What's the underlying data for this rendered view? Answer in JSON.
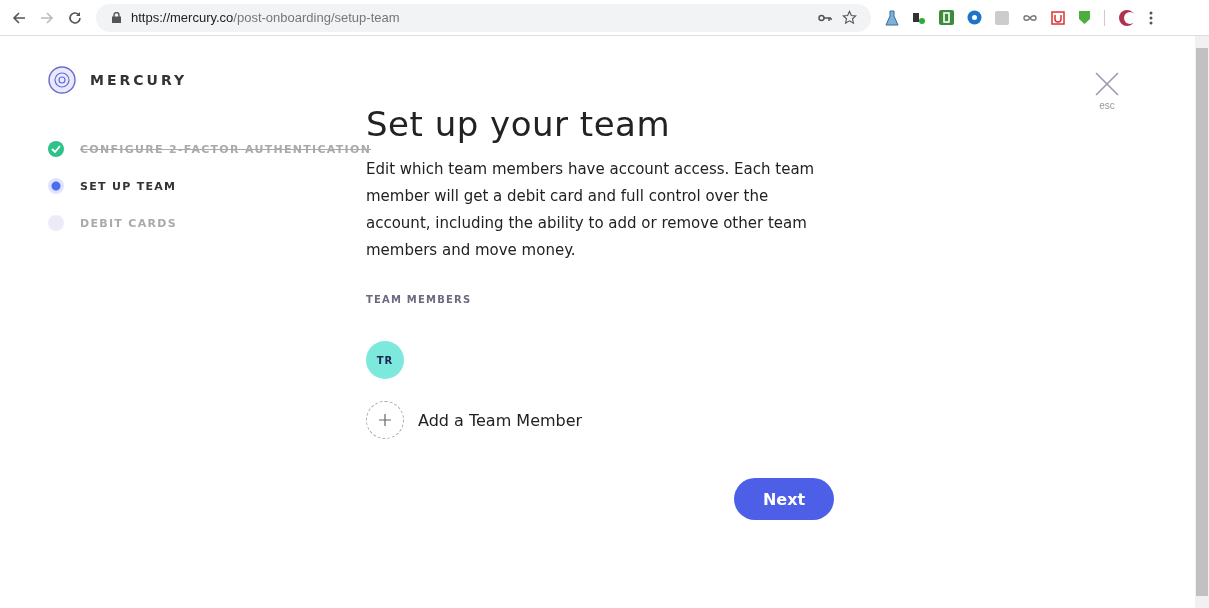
{
  "browser": {
    "url_host": "https://mercury.co",
    "url_path": "/post-onboarding/setup-team"
  },
  "brand": {
    "name": "MERCURY"
  },
  "steps": [
    {
      "label": "CONFIGURE 2-FACTOR AUTHENTICATION",
      "completed": true,
      "selected": false
    },
    {
      "label": "SET UP TEAM",
      "completed": false,
      "selected": true
    },
    {
      "label": "DEBIT CARDS",
      "completed": false,
      "selected": false
    }
  ],
  "close": {
    "hint": "esc"
  },
  "title": "Set up your team",
  "description": "Edit which team members have account access. Each team member will get a debit card and full control over the account, including the ability to add or remove other team members and move money.",
  "team": {
    "heading": "TEAM MEMBERS",
    "members": [
      {
        "initials": "TR",
        "color": "#7de8dc"
      }
    ],
    "add_label": "Add a Team Member"
  },
  "next_button": "Next"
}
